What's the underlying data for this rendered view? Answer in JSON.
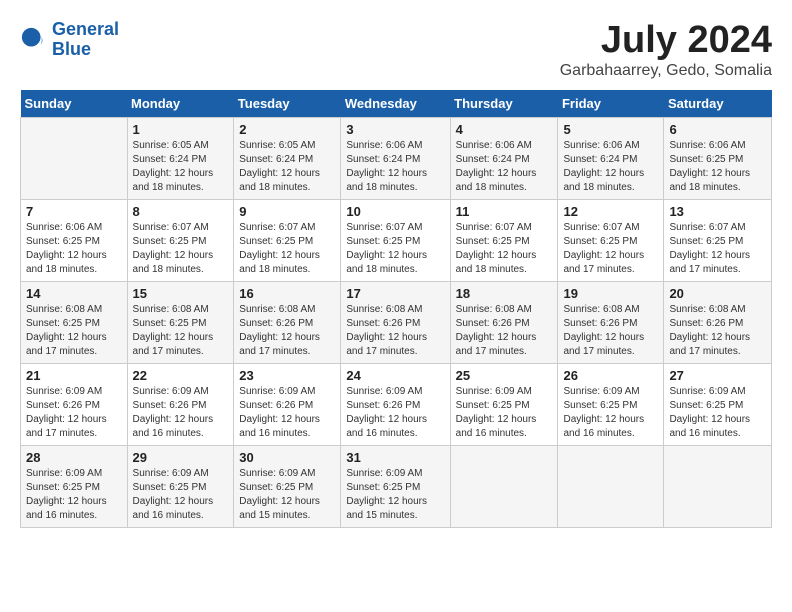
{
  "logo": {
    "line1": "General",
    "line2": "Blue"
  },
  "title": "July 2024",
  "location": "Garbahaarrey, Gedo, Somalia",
  "days_header": [
    "Sunday",
    "Monday",
    "Tuesday",
    "Wednesday",
    "Thursday",
    "Friday",
    "Saturday"
  ],
  "weeks": [
    [
      {
        "day": "",
        "info": ""
      },
      {
        "day": "1",
        "info": "Sunrise: 6:05 AM\nSunset: 6:24 PM\nDaylight: 12 hours\nand 18 minutes."
      },
      {
        "day": "2",
        "info": "Sunrise: 6:05 AM\nSunset: 6:24 PM\nDaylight: 12 hours\nand 18 minutes."
      },
      {
        "day": "3",
        "info": "Sunrise: 6:06 AM\nSunset: 6:24 PM\nDaylight: 12 hours\nand 18 minutes."
      },
      {
        "day": "4",
        "info": "Sunrise: 6:06 AM\nSunset: 6:24 PM\nDaylight: 12 hours\nand 18 minutes."
      },
      {
        "day": "5",
        "info": "Sunrise: 6:06 AM\nSunset: 6:24 PM\nDaylight: 12 hours\nand 18 minutes."
      },
      {
        "day": "6",
        "info": "Sunrise: 6:06 AM\nSunset: 6:25 PM\nDaylight: 12 hours\nand 18 minutes."
      }
    ],
    [
      {
        "day": "7",
        "info": "Sunrise: 6:06 AM\nSunset: 6:25 PM\nDaylight: 12 hours\nand 18 minutes."
      },
      {
        "day": "8",
        "info": "Sunrise: 6:07 AM\nSunset: 6:25 PM\nDaylight: 12 hours\nand 18 minutes."
      },
      {
        "day": "9",
        "info": "Sunrise: 6:07 AM\nSunset: 6:25 PM\nDaylight: 12 hours\nand 18 minutes."
      },
      {
        "day": "10",
        "info": "Sunrise: 6:07 AM\nSunset: 6:25 PM\nDaylight: 12 hours\nand 18 minutes."
      },
      {
        "day": "11",
        "info": "Sunrise: 6:07 AM\nSunset: 6:25 PM\nDaylight: 12 hours\nand 18 minutes."
      },
      {
        "day": "12",
        "info": "Sunrise: 6:07 AM\nSunset: 6:25 PM\nDaylight: 12 hours\nand 17 minutes."
      },
      {
        "day": "13",
        "info": "Sunrise: 6:07 AM\nSunset: 6:25 PM\nDaylight: 12 hours\nand 17 minutes."
      }
    ],
    [
      {
        "day": "14",
        "info": "Sunrise: 6:08 AM\nSunset: 6:25 PM\nDaylight: 12 hours\nand 17 minutes."
      },
      {
        "day": "15",
        "info": "Sunrise: 6:08 AM\nSunset: 6:25 PM\nDaylight: 12 hours\nand 17 minutes."
      },
      {
        "day": "16",
        "info": "Sunrise: 6:08 AM\nSunset: 6:26 PM\nDaylight: 12 hours\nand 17 minutes."
      },
      {
        "day": "17",
        "info": "Sunrise: 6:08 AM\nSunset: 6:26 PM\nDaylight: 12 hours\nand 17 minutes."
      },
      {
        "day": "18",
        "info": "Sunrise: 6:08 AM\nSunset: 6:26 PM\nDaylight: 12 hours\nand 17 minutes."
      },
      {
        "day": "19",
        "info": "Sunrise: 6:08 AM\nSunset: 6:26 PM\nDaylight: 12 hours\nand 17 minutes."
      },
      {
        "day": "20",
        "info": "Sunrise: 6:08 AM\nSunset: 6:26 PM\nDaylight: 12 hours\nand 17 minutes."
      }
    ],
    [
      {
        "day": "21",
        "info": "Sunrise: 6:09 AM\nSunset: 6:26 PM\nDaylight: 12 hours\nand 17 minutes."
      },
      {
        "day": "22",
        "info": "Sunrise: 6:09 AM\nSunset: 6:26 PM\nDaylight: 12 hours\nand 16 minutes."
      },
      {
        "day": "23",
        "info": "Sunrise: 6:09 AM\nSunset: 6:26 PM\nDaylight: 12 hours\nand 16 minutes."
      },
      {
        "day": "24",
        "info": "Sunrise: 6:09 AM\nSunset: 6:26 PM\nDaylight: 12 hours\nand 16 minutes."
      },
      {
        "day": "25",
        "info": "Sunrise: 6:09 AM\nSunset: 6:25 PM\nDaylight: 12 hours\nand 16 minutes."
      },
      {
        "day": "26",
        "info": "Sunrise: 6:09 AM\nSunset: 6:25 PM\nDaylight: 12 hours\nand 16 minutes."
      },
      {
        "day": "27",
        "info": "Sunrise: 6:09 AM\nSunset: 6:25 PM\nDaylight: 12 hours\nand 16 minutes."
      }
    ],
    [
      {
        "day": "28",
        "info": "Sunrise: 6:09 AM\nSunset: 6:25 PM\nDaylight: 12 hours\nand 16 minutes."
      },
      {
        "day": "29",
        "info": "Sunrise: 6:09 AM\nSunset: 6:25 PM\nDaylight: 12 hours\nand 16 minutes."
      },
      {
        "day": "30",
        "info": "Sunrise: 6:09 AM\nSunset: 6:25 PM\nDaylight: 12 hours\nand 15 minutes."
      },
      {
        "day": "31",
        "info": "Sunrise: 6:09 AM\nSunset: 6:25 PM\nDaylight: 12 hours\nand 15 minutes."
      },
      {
        "day": "",
        "info": ""
      },
      {
        "day": "",
        "info": ""
      },
      {
        "day": "",
        "info": ""
      }
    ]
  ]
}
